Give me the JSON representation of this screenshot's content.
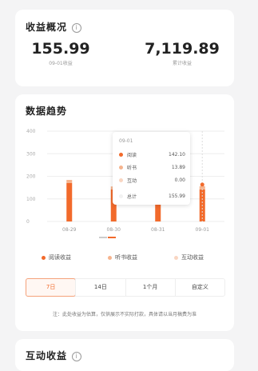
{
  "overview": {
    "title": "收益概况",
    "info_icon": "i",
    "yesterday_amount": "155.99",
    "yesterday_label": "09-01收益",
    "total_amount": "7,119.89",
    "total_label": "累计收益"
  },
  "trend": {
    "title": "数据趋势",
    "tooltip": {
      "date": "09-01",
      "rows": [
        {
          "name": "阅读",
          "value": "142.10"
        },
        {
          "name": "听书",
          "value": "13.89"
        },
        {
          "name": "互动",
          "value": "0.00"
        }
      ],
      "total_name": "总计",
      "total_value": "155.99"
    },
    "legend": [
      "阅读收益",
      "听书收益",
      "互动收益"
    ],
    "range_tabs": [
      "7日",
      "14日",
      "1个月",
      "自定义"
    ],
    "note": "注：此处收益为估算，仅供展示不实际打款，具体请以当月稿费为准"
  },
  "interact": {
    "title": "互动收益",
    "info_icon": "i"
  },
  "colors": {
    "reading": "#f26a2b",
    "listening": "#f6b48e",
    "interaction": "#f9d6c2",
    "accent": "#f26a2b"
  },
  "chart_data": {
    "type": "bar",
    "stacked": true,
    "categories": [
      "08-29",
      "08-30",
      "08-31",
      "09-01"
    ],
    "series": [
      {
        "name": "阅读收益",
        "values": [
          170,
          142,
          145,
          142.1
        ]
      },
      {
        "name": "听书收益",
        "values": [
          14,
          13,
          13,
          13.89
        ]
      },
      {
        "name": "互动收益",
        "values": [
          0,
          0,
          0,
          0
        ]
      }
    ],
    "ylim": [
      0,
      400
    ],
    "yticks": [
      "0",
      "100",
      "200",
      "300",
      "400"
    ],
    "grid": true,
    "legend_position": "bottom"
  }
}
